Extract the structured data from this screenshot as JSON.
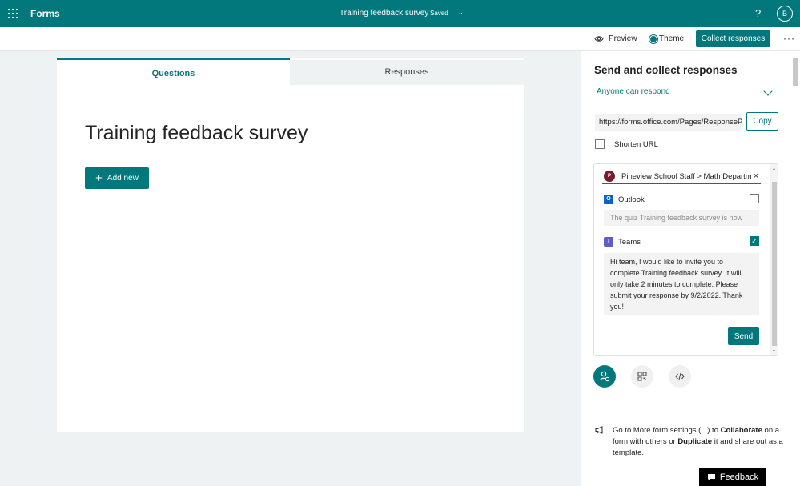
{
  "topbar": {
    "app_name": "Forms",
    "doc_title": "Training feedback survey",
    "saved": "Saved",
    "help": "?",
    "avatar_initial": "B"
  },
  "commandbar": {
    "preview": "Preview",
    "theme": "Theme",
    "collect": "Collect responses",
    "more": "···"
  },
  "tabs": {
    "questions": "Questions",
    "responses": "Responses"
  },
  "form": {
    "title": "Training feedback survey",
    "add_new": "Add new"
  },
  "panel": {
    "title": "Send and collect responses",
    "audience": "Anyone can respond",
    "url": "https://forms.office.com/Pages/ResponsePage.aspx",
    "copy": "Copy",
    "shorten_label": "Shorten URL",
    "recipient_initial": "P",
    "recipient": "Pineview School Staff > Math Department",
    "outlook_label": "Outlook",
    "outlook_message": "The quiz Training feedback survey is now",
    "outlook_checked": false,
    "teams_label": "Teams",
    "teams_checked": true,
    "teams_message": "Hi team, I would like to invite you to complete Training feedback survey. It will only take 2 minutes to complete. Please submit your response by 9/2/2022. Thank you!",
    "send": "Send",
    "tip_1": "Go to More form settings (...) to ",
    "tip_collaborate": "Collaborate",
    "tip_2": " on a form with others or ",
    "tip_duplicate": "Duplicate",
    "tip_3": " it and share out as a template."
  },
  "feedback": "Feedback",
  "colors": {
    "accent": "#03787c",
    "background": "#eef2f3"
  }
}
